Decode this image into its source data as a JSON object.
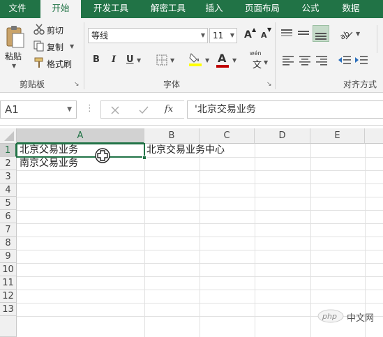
{
  "tabs": [
    "文件",
    "开始",
    "开发工具",
    "解密工具",
    "插入",
    "页面布局",
    "公式",
    "数据"
  ],
  "clipboard": {
    "paste": "粘贴",
    "cut": "剪切",
    "copy": "复制",
    "format_painter": "格式刷",
    "group_label": "剪贴板"
  },
  "font": {
    "name": "等线",
    "size": "11",
    "group_label": "字体",
    "bold": "B",
    "italic": "I",
    "underline": "U",
    "grow": "A",
    "shrink": "A",
    "font_color_letter": "A",
    "highlight_color": "#ffff00",
    "font_color": "#c00000",
    "phonetic_top": "wén",
    "phonetic_bottom": "文"
  },
  "alignment": {
    "group_label": "对齐方式"
  },
  "formula_bar": {
    "name_box": "A1",
    "fx": "fx",
    "content": "'北京交易业务"
  },
  "columns": [
    "A",
    "B",
    "C",
    "D",
    "E"
  ],
  "rows": [
    "1",
    "2",
    "3",
    "4",
    "5",
    "6",
    "7",
    "8",
    "9",
    "10",
    "11",
    "12",
    "13"
  ],
  "cells": {
    "A1": "北京父易业务",
    "A2": "南京父易业务",
    "B1": "北京交易业务中心"
  },
  "watermark": "中文网",
  "colors": {
    "accent": "#217346"
  }
}
